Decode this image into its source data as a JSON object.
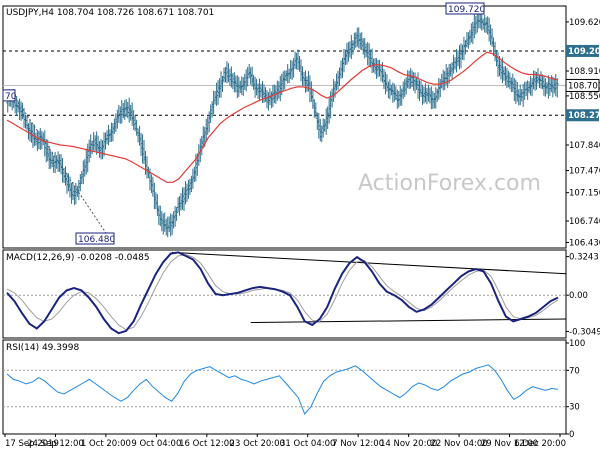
{
  "chart_data": [
    {
      "type": "candlestick",
      "header": "USDJPY,H4  108.704 108.726 108.671 108.701",
      "watermark": "ActionForex.com",
      "y_ticks": [
        109.62,
        109.2,
        108.91,
        108.701,
        108.55,
        108.27,
        107.84,
        107.47,
        107.15,
        106.74,
        106.43
      ],
      "ylim": [
        106.35,
        109.85
      ],
      "highlighted_levels": [
        {
          "label": "109.200",
          "value": 109.2,
          "style": "dashed"
        },
        {
          "label": "108.701",
          "value": 108.701,
          "style": "current"
        },
        {
          "label": "108.270",
          "value": 108.27,
          "style": "dashed"
        }
      ],
      "annotations": [
        {
          "label": "109.720",
          "value": 109.72
        },
        {
          "label": "106.480",
          "value": 106.48
        },
        {
          "label": "70",
          "value": 108.55
        }
      ],
      "moving_average_color": "#e53935",
      "price_color": "#2e6f8e",
      "close_series": [
        108.45,
        108.52,
        108.38,
        108.2,
        108.05,
        107.88,
        107.95,
        107.7,
        107.55,
        107.6,
        107.35,
        107.1,
        107.2,
        107.45,
        107.8,
        107.9,
        107.75,
        107.95,
        108.1,
        108.25,
        108.4,
        108.3,
        108.05,
        107.75,
        107.4,
        107.05,
        106.8,
        106.6,
        106.75,
        106.95,
        107.1,
        107.25,
        107.55,
        107.85,
        108.2,
        108.45,
        108.7,
        108.9,
        108.8,
        108.65,
        108.75,
        108.85,
        108.7,
        108.6,
        108.5,
        108.55,
        108.65,
        108.8,
        108.95,
        109.05,
        108.85,
        108.7,
        108.35,
        108.0,
        108.2,
        108.55,
        108.85,
        109.05,
        109.25,
        109.4,
        109.3,
        109.15,
        109.0,
        108.9,
        108.75,
        108.6,
        108.5,
        108.65,
        108.8,
        108.75,
        108.6,
        108.55,
        108.5,
        108.65,
        108.8,
        108.95,
        109.05,
        109.2,
        109.4,
        109.55,
        109.65,
        109.6,
        109.3,
        109.0,
        108.85,
        108.75,
        108.6,
        108.55,
        108.65,
        108.8,
        108.75,
        108.7,
        108.68,
        108.7
      ],
      "ma_series": [
        108.2,
        108.15,
        108.1,
        108.05,
        108.0,
        107.95,
        107.9,
        107.88,
        107.86,
        107.84,
        107.83,
        107.82,
        107.8,
        107.78,
        107.76,
        107.74,
        107.72,
        107.7,
        107.68,
        107.66,
        107.64,
        107.6,
        107.55,
        107.5,
        107.45,
        107.4,
        107.35,
        107.3,
        107.3,
        107.35,
        107.45,
        107.55,
        107.65,
        107.8,
        107.95,
        108.05,
        108.15,
        108.22,
        108.28,
        108.33,
        108.38,
        108.42,
        108.46,
        108.5,
        108.53,
        108.56,
        108.6,
        108.63,
        108.66,
        108.68,
        108.68,
        108.66,
        108.62,
        108.56,
        108.52,
        108.55,
        108.62,
        108.7,
        108.78,
        108.85,
        108.92,
        108.97,
        109.0,
        109.0,
        108.98,
        108.95,
        108.9,
        108.86,
        108.84,
        108.82,
        108.78,
        108.74,
        108.72,
        108.72,
        108.74,
        108.78,
        108.84,
        108.9,
        108.97,
        109.05,
        109.12,
        109.18,
        109.16,
        109.1,
        109.03,
        108.97,
        108.92,
        108.88,
        108.86,
        108.86,
        108.85,
        108.83,
        108.8,
        108.78
      ]
    },
    {
      "type": "line",
      "header": "MACD(12,26,9) -0.0208 -0.0485",
      "y_ticks": [
        0.3243,
        0.0,
        -0.3049
      ],
      "y_tick_labels": [
        "0.3243",
        "0.00",
        "-0.3049"
      ],
      "ylim": [
        -0.36,
        0.38
      ],
      "macd_color": "#1a237e",
      "signal_color": "#9e9e9e",
      "macd_series": [
        0.02,
        -0.05,
        -0.15,
        -0.24,
        -0.28,
        -0.22,
        -0.12,
        -0.02,
        0.04,
        0.06,
        0.04,
        -0.02,
        -0.1,
        -0.2,
        -0.28,
        -0.32,
        -0.3,
        -0.22,
        -0.08,
        0.05,
        0.18,
        0.28,
        0.35,
        0.36,
        0.33,
        0.3,
        0.22,
        0.1,
        0.01,
        0.0,
        0.01,
        0.02,
        0.04,
        0.06,
        0.07,
        0.06,
        0.05,
        0.03,
        0.0,
        -0.1,
        -0.22,
        -0.25,
        -0.2,
        -0.1,
        0.05,
        0.18,
        0.27,
        0.32,
        0.28,
        0.2,
        0.1,
        0.03,
        0.0,
        -0.04,
        -0.1,
        -0.14,
        -0.12,
        -0.08,
        -0.02,
        0.04,
        0.1,
        0.16,
        0.2,
        0.22,
        0.2,
        0.1,
        -0.05,
        -0.18,
        -0.22,
        -0.2,
        -0.18,
        -0.15,
        -0.1,
        -0.05,
        -0.02
      ],
      "signal_series": [
        0.05,
        0.02,
        -0.04,
        -0.12,
        -0.19,
        -0.22,
        -0.2,
        -0.14,
        -0.06,
        0.0,
        0.03,
        0.02,
        -0.03,
        -0.1,
        -0.18,
        -0.25,
        -0.29,
        -0.27,
        -0.18,
        -0.06,
        0.07,
        0.19,
        0.28,
        0.33,
        0.34,
        0.32,
        0.27,
        0.18,
        0.08,
        0.03,
        0.01,
        0.01,
        0.02,
        0.04,
        0.05,
        0.06,
        0.05,
        0.04,
        0.02,
        -0.04,
        -0.14,
        -0.21,
        -0.22,
        -0.16,
        -0.04,
        0.1,
        0.21,
        0.28,
        0.29,
        0.24,
        0.16,
        0.08,
        0.03,
        -0.01,
        -0.06,
        -0.11,
        -0.13,
        -0.1,
        -0.05,
        0.01,
        0.07,
        0.12,
        0.17,
        0.2,
        0.21,
        0.16,
        0.04,
        -0.1,
        -0.18,
        -0.2,
        -0.19,
        -0.17,
        -0.13,
        -0.08,
        -0.04
      ],
      "trendlines": [
        {
          "from": [
            0.3,
            0.36
          ],
          "to": [
            1.0,
            0.18
          ]
        },
        {
          "from": [
            0.44,
            -0.23
          ],
          "to": [
            1.0,
            -0.2
          ]
        }
      ]
    },
    {
      "type": "line",
      "header": "RSI(14) 49.3998",
      "y_ticks": [
        100,
        70,
        30,
        0
      ],
      "y_tick_labels": [
        "100",
        "70",
        "30",
        "0"
      ],
      "ylim": [
        0,
        100
      ],
      "rsi_color": "#1e88e5",
      "rsi_series": [
        66,
        60,
        58,
        55,
        57,
        62,
        58,
        52,
        46,
        44,
        48,
        52,
        56,
        60,
        55,
        50,
        45,
        40,
        36,
        40,
        48,
        55,
        60,
        52,
        46,
        40,
        36,
        45,
        58,
        66,
        70,
        72,
        74,
        70,
        66,
        62,
        64,
        60,
        58,
        55,
        58,
        60,
        62,
        64,
        56,
        48,
        40,
        22,
        30,
        45,
        58,
        64,
        68,
        70,
        72,
        75,
        70,
        64,
        58,
        52,
        48,
        44,
        40,
        45,
        52,
        56,
        54,
        50,
        48,
        52,
        58,
        62,
        66,
        68,
        72,
        74,
        76,
        70,
        60,
        48,
        38,
        42,
        48,
        52,
        50,
        48,
        50,
        49
      ]
    }
  ],
  "x_tick_labels": [
    "17 Sep 2019",
    "24 Sep 12:00",
    "1 Oct 20:00",
    "9 Oct 04:00",
    "16 Oct 12:00",
    "23 Oct 20:00",
    "31 Oct 04:00",
    "7 Nov 12:00",
    "14 Nov 20:00",
    "22 Nov 04:00",
    "29 Nov 12:00",
    "6 Dec 20:00"
  ]
}
